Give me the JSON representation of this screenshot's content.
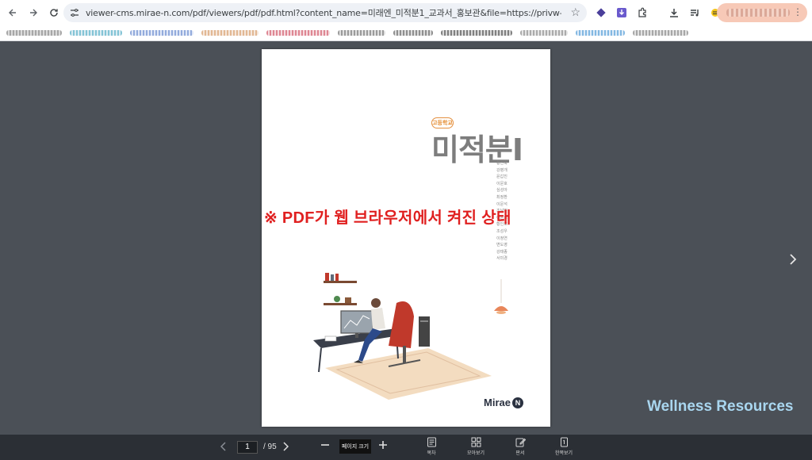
{
  "browser": {
    "url": "viewer-cms.mirae-n.com/pdf/viewers/pdf/pdf.html?content_name=미래엔_미적분1_교과서_홍보관&file=https://privw-cms.mirae-n.com/docu..."
  },
  "pdf_page": {
    "grade_badge": "고등학교",
    "title": "미적분Ⅰ",
    "authors": [
      "황선욱",
      "강병개",
      "윤갑진",
      "이문호",
      "심성아",
      "최정환",
      "이문석",
      "조남민",
      "이은호",
      "황인호",
      "조성우",
      "이정연",
      "변도영",
      "강태종",
      "서미경"
    ],
    "publisher_logo": "Mirae",
    "publisher_logo_mark": "N"
  },
  "overlay": {
    "notice": "※ PDF가 웹 브라우저에서 켜진 상태"
  },
  "watermark": "Wellness Resources",
  "bottom_bar": {
    "page_current": "1",
    "page_total": "/ 95",
    "zoom_label": "페이지 크기",
    "tools": [
      {
        "label": "목차",
        "icon": "toc-icon"
      },
      {
        "label": "모아보기",
        "icon": "grid-icon"
      },
      {
        "label": "판서",
        "icon": "pen-icon"
      },
      {
        "label": "한쪽보기",
        "icon": "single-page-icon"
      }
    ]
  },
  "colors": {
    "viewer_bg": "#4b5057",
    "bottom_bar_bg": "#2b2f35",
    "overlay_text": "#e02020",
    "watermark": "#a9d6ef"
  }
}
